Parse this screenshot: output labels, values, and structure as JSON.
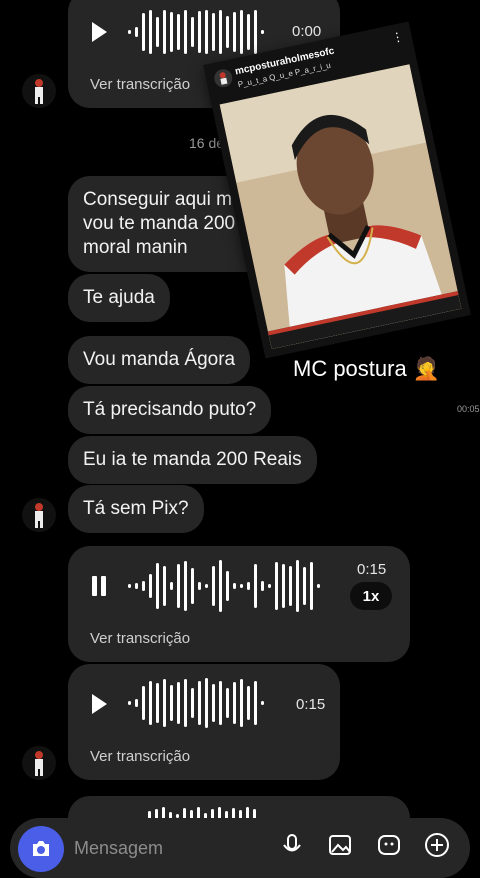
{
  "chat": {
    "voice_top": {
      "time": "0:00",
      "transcript_label": "Ver transcrição"
    },
    "date_separator": "16 de f",
    "messages": [
      {
        "line1": "Conseguir aqui mai",
        "line2": "vou te manda 200 re",
        "line3": "moral manin"
      },
      {
        "text": "Te ajuda"
      },
      {
        "text": "Vou manda Ágora"
      },
      {
        "text": "Tá precisando puto?"
      },
      {
        "text": "Eu ia te manda 200 Reais"
      },
      {
        "text": "Tá sem Pix?"
      }
    ],
    "voice_playing": {
      "time": "0:15",
      "speed": "1x",
      "transcript_label": "Ver transcrição"
    },
    "voice_second": {
      "time": "0:15",
      "transcript_label": "Ver transcrição"
    },
    "side_time": "00:05"
  },
  "shared_post": {
    "handle": "mcposturaholmesofc",
    "subline": "P_u_t_a Q_u_e P_a_r_i_u",
    "menu_icon": "more-vertical-icon",
    "caption": "MC postura 🤦"
  },
  "composer": {
    "placeholder": "Mensagem",
    "icons": [
      "camera-icon",
      "microphone-icon",
      "image-icon",
      "sticker-icon",
      "plus-icon"
    ],
    "camera_color": "#4a5ee8"
  }
}
